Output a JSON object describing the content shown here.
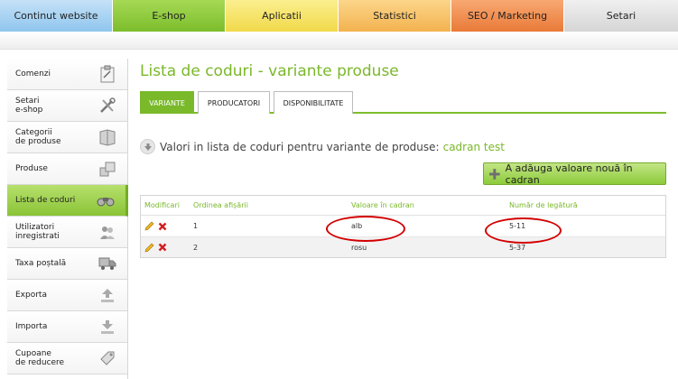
{
  "nav": {
    "tabs": [
      {
        "label": "Continut website"
      },
      {
        "label": "E-shop"
      },
      {
        "label": "Aplicatii"
      },
      {
        "label": "Statistici"
      },
      {
        "label": "SEO / Marketing"
      },
      {
        "label": "Setari"
      }
    ],
    "active_index": 1
  },
  "sidebar": {
    "items": [
      {
        "label": "Comenzi",
        "icon": "clipboard-icon"
      },
      {
        "label": "Setari\ne-shop",
        "icon": "tools-icon"
      },
      {
        "label": "Categorii\nde produse",
        "icon": "book-icon"
      },
      {
        "label": "Produse",
        "icon": "boxes-icon"
      },
      {
        "label": "Lista de coduri",
        "icon": "binoculars-icon"
      },
      {
        "label": "Utilizatori\ninregistrati",
        "icon": "users-icon"
      },
      {
        "label": "Taxa poștală",
        "icon": "truck-icon"
      },
      {
        "label": "Exporta",
        "icon": "upload-icon"
      },
      {
        "label": "Importa",
        "icon": "download-icon"
      },
      {
        "label": "Cupoane\nde reducere",
        "icon": "tag-icon"
      }
    ],
    "active_index": 4
  },
  "main": {
    "title": "Lista de coduri - variante produse",
    "subtabs": [
      {
        "label": "VARIANTE"
      },
      {
        "label": "PRODUCATORI"
      },
      {
        "label": "DISPONIBILITATE"
      }
    ],
    "info_text": "Valori in lista de coduri pentru variante de produse:",
    "info_link": "cadran test",
    "add_button": "A adăuga valoare nouă în cadran"
  },
  "table": {
    "headers": [
      "Modificari",
      "Ordinea afișării",
      "Valoare în cadran",
      "Număr de legătură"
    ],
    "rows": [
      {
        "order": "1",
        "value": "alb",
        "link": "5-11"
      },
      {
        "order": "2",
        "value": "rosu",
        "link": "5-37"
      }
    ]
  },
  "colors": {
    "accent_green": "#7ab829",
    "annotation_red": "#d30000"
  }
}
